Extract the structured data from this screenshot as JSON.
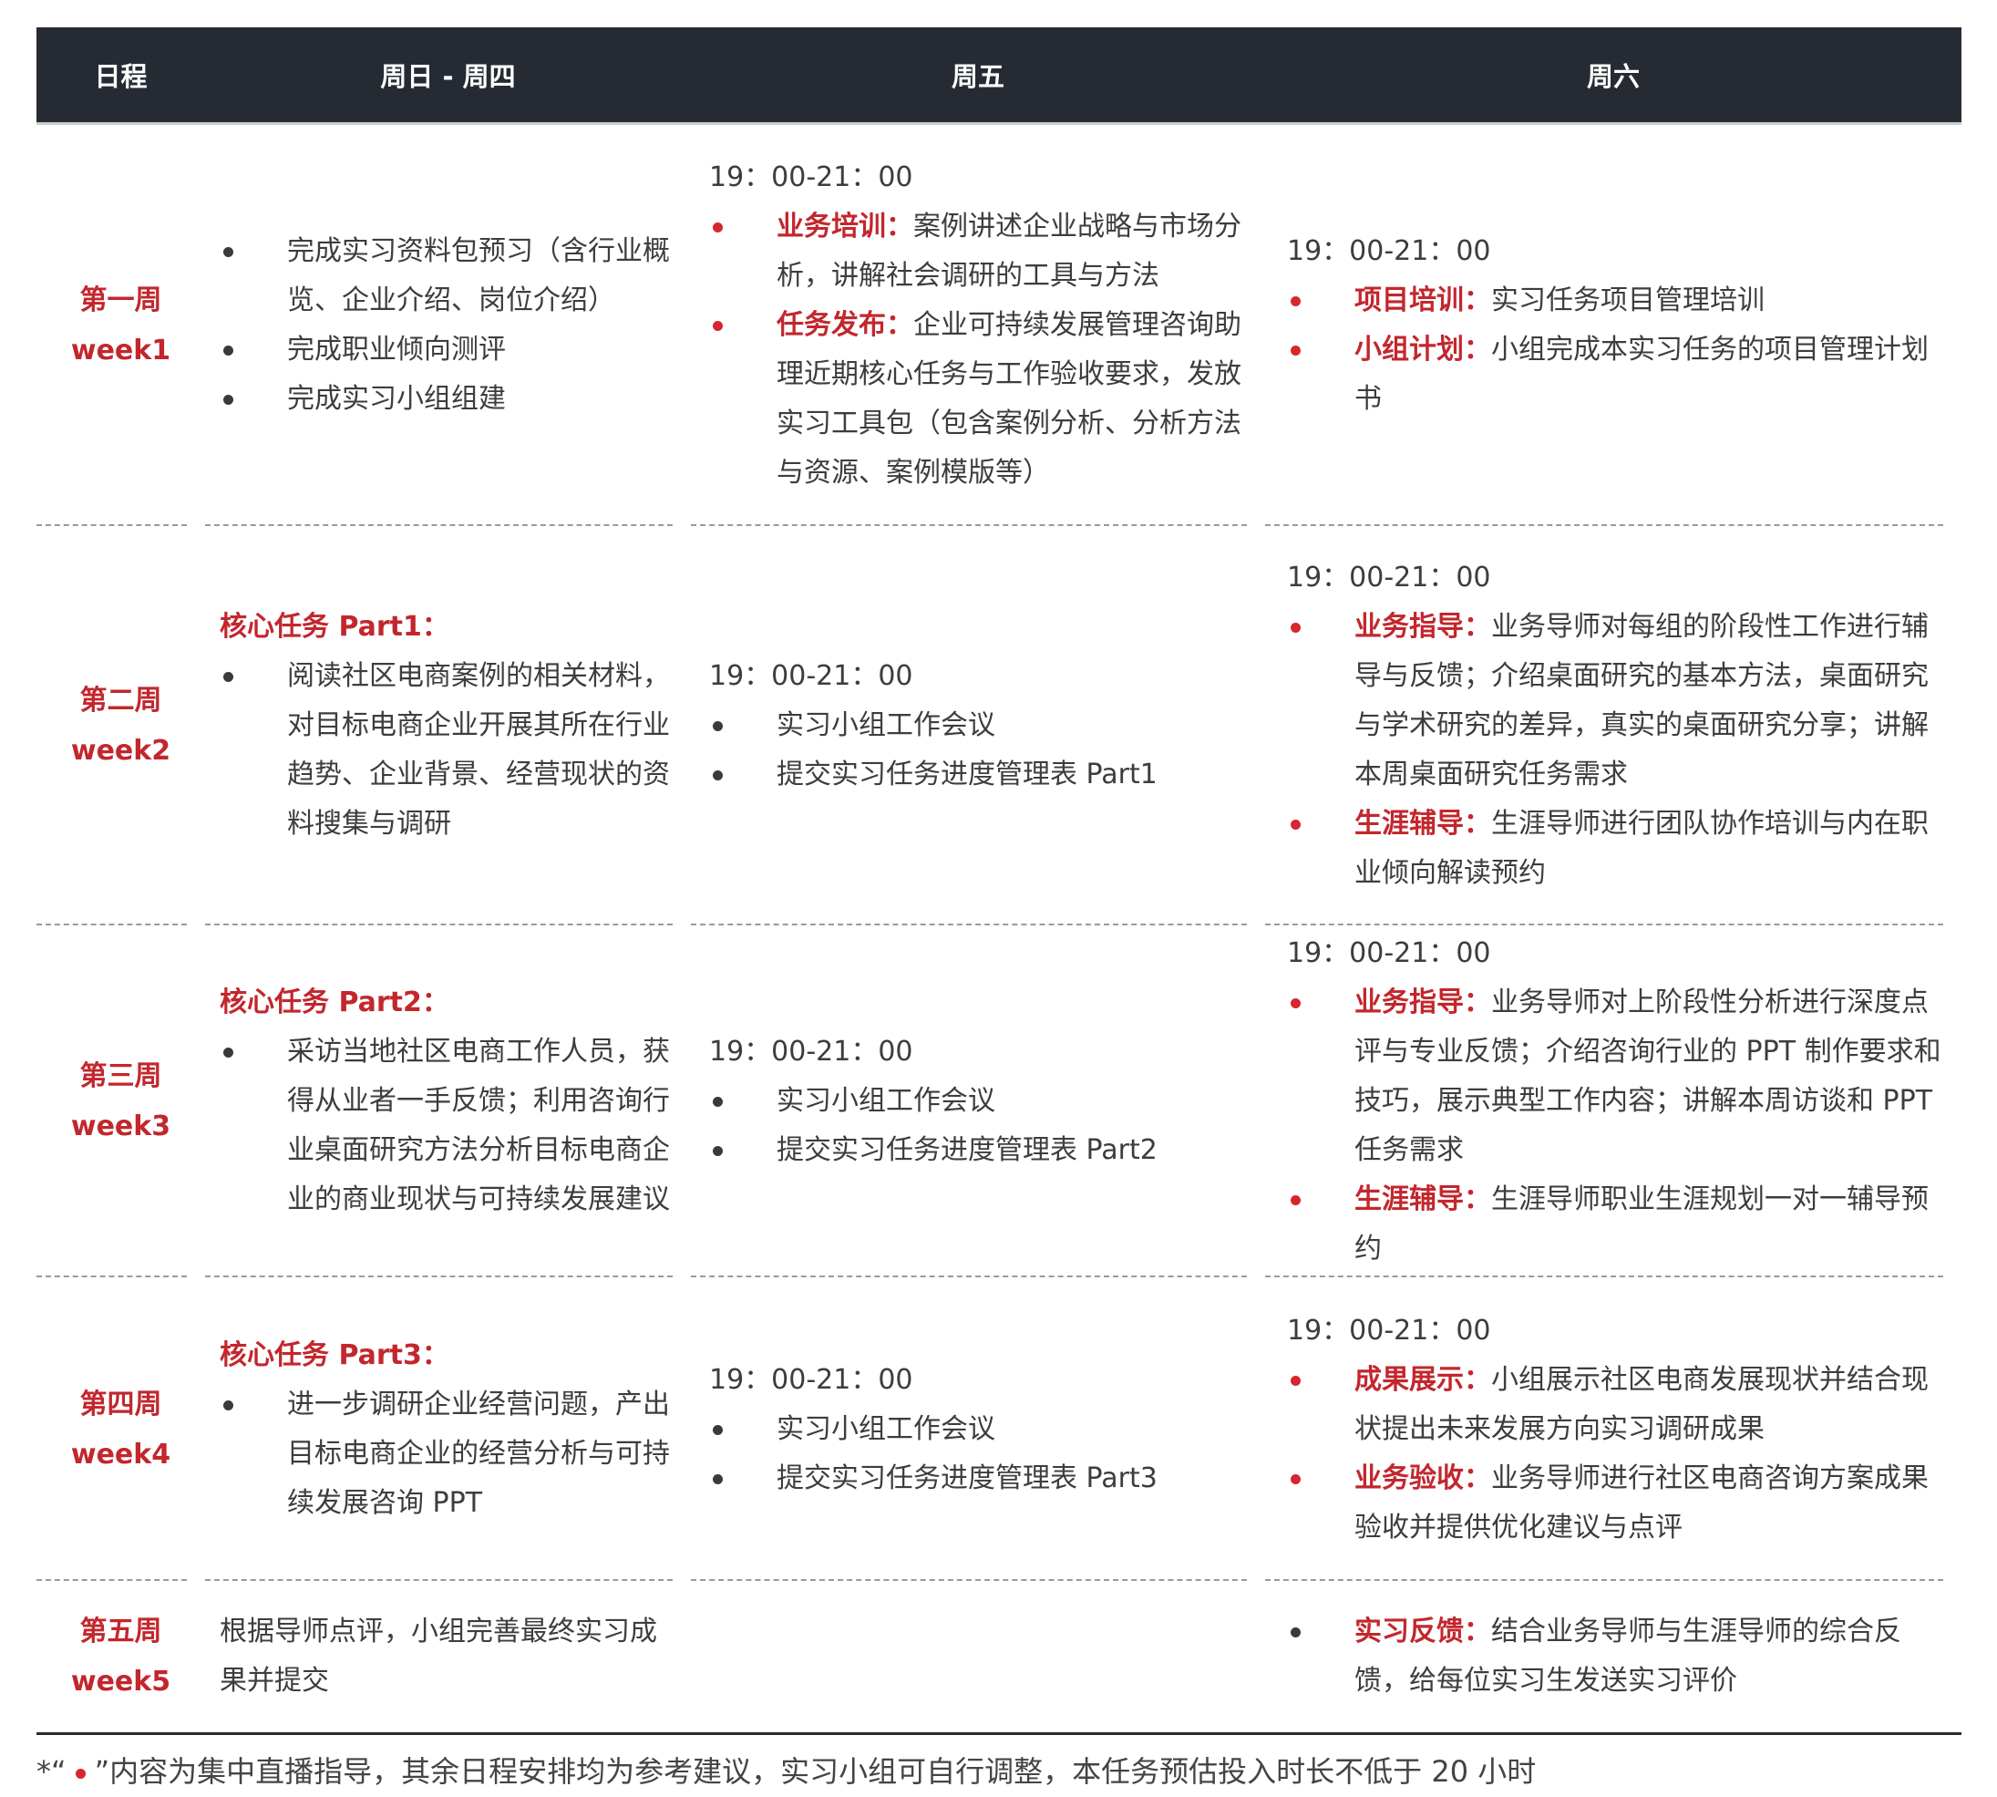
{
  "header": {
    "col0": "日程",
    "col1": "周日 - 周四",
    "col2": "周五",
    "col3": "周六"
  },
  "weeks": [
    {
      "cn": "第一周",
      "en": "week1",
      "sun_thu": {
        "items": [
          "完成实习资料包预习（含行业概览、企业介绍、岗位介绍）",
          "完成职业倾向测评",
          "完成实习小组组建"
        ]
      },
      "fri": {
        "time": "19：00-21：00",
        "items": [
          {
            "label": "业务培训：",
            "text": "案例讲述企业战略与市场分析，讲解社会调研的工具与方法"
          },
          {
            "label": "任务发布：",
            "text": "企业可持续发展管理咨询助理近期核心任务与工作验收要求，发放实习工具包（包含案例分析、分析方法与资源、案例模版等）"
          }
        ]
      },
      "sat": {
        "time": "19：00-21：00",
        "items": [
          {
            "label": "项目培训：",
            "text": "实习任务项目管理培训"
          },
          {
            "label": "小组计划：",
            "text": "小组完成本实习任务的项目管理计划书"
          }
        ]
      }
    },
    {
      "cn": "第二周",
      "en": "week2",
      "sun_thu": {
        "title": "核心任务 Part1：",
        "items": [
          "阅读社区电商案例的相关材料，对目标电商企业开展其所在行业趋势、企业背景、经营现状的资料搜集与调研"
        ]
      },
      "fri": {
        "time": "19：00-21：00",
        "items": [
          "实习小组工作会议",
          "提交实习任务进度管理表 Part1"
        ]
      },
      "sat": {
        "time": "19：00-21：00",
        "items": [
          {
            "label": "业务指导：",
            "text": "业务导师对每组的阶段性工作进行辅导与反馈；介绍桌面研究的基本方法，桌面研究与学术研究的差异，真实的桌面研究分享；讲解本周桌面研究任务需求"
          },
          {
            "label": "生涯辅导：",
            "text": "生涯导师进行团队协作培训与内在职业倾向解读预约"
          }
        ]
      }
    },
    {
      "cn": "第三周",
      "en": "week3",
      "sun_thu": {
        "title": "核心任务 Part2：",
        "items": [
          "采访当地社区电商工作人员，获得从业者一手反馈；利用咨询行业桌面研究方法分析目标电商企业的商业现状与可持续发展建议"
        ]
      },
      "fri": {
        "time": "19：00-21：00",
        "items": [
          "实习小组工作会议",
          "提交实习任务进度管理表 Part2"
        ]
      },
      "sat": {
        "time": "19：00-21：00",
        "items": [
          {
            "label": "业务指导：",
            "text": "业务导师对上阶段性分析进行深度点评与专业反馈；介绍咨询行业的 PPT 制作要求和技巧，展示典型工作内容；讲解本周访谈和 PPT 任务需求"
          },
          {
            "label": "生涯辅导：",
            "text": "生涯导师职业生涯规划一对一辅导预约"
          }
        ]
      }
    },
    {
      "cn": "第四周",
      "en": "week4",
      "sun_thu": {
        "title": "核心任务 Part3：",
        "items": [
          "进一步调研企业经营问题，产出目标电商企业的经营分析与可持续发展咨询 PPT"
        ]
      },
      "fri": {
        "time": "19：00-21：00",
        "items": [
          "实习小组工作会议",
          "提交实习任务进度管理表 Part3"
        ]
      },
      "sat": {
        "time": "19：00-21：00",
        "items": [
          {
            "label": "成果展示：",
            "text": "小组展示社区电商发展现状并结合现状提出未来发展方向实习调研成果"
          },
          {
            "label": "业务验收：",
            "text": "业务导师进行社区电商咨询方案成果验收并提供优化建议与点评"
          }
        ]
      }
    },
    {
      "cn": "第五周",
      "en": "week5",
      "sun_thu": {
        "plain": "根据导师点评，小组完善最终实习成果并提交"
      },
      "sat": {
        "items": [
          {
            "label": "实习反馈：",
            "text": "结合业务导师与生涯导师的综合反馈，给每位实习生发送实习评价"
          }
        ]
      }
    }
  ],
  "footnote": {
    "prefix": "*“",
    "suffix": "”内容为集中直播指导，其余日程安排均为参考建议，实习小组可自行调整，本任务预估投入时长不低于 20 小时"
  },
  "colors": {
    "header_bg": "#262b33",
    "accent_red": "#c2272d",
    "bullet_red": "#d6262e",
    "text": "#3d3d3d"
  }
}
